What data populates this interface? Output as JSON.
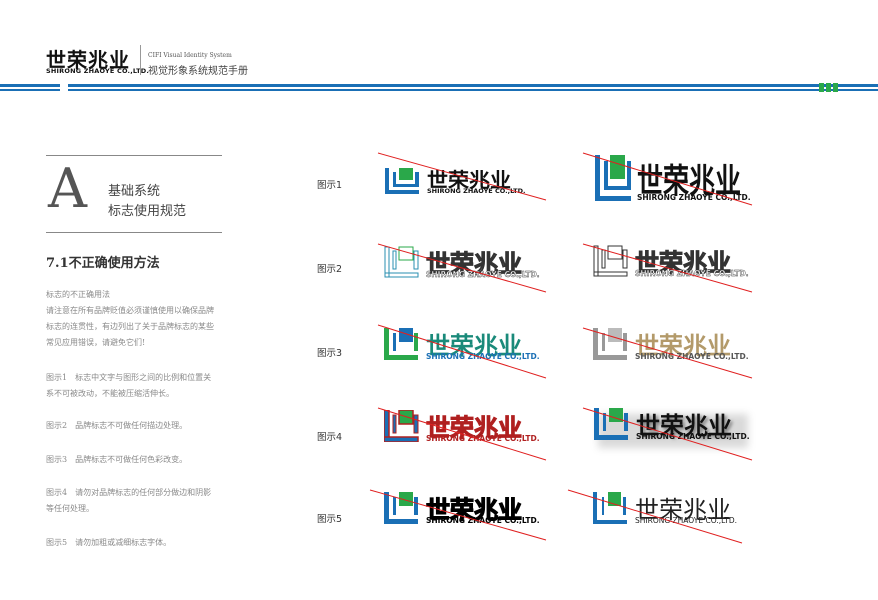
{
  "header": {
    "brand_cn": "世荣兆业",
    "brand_en": "SHIRONG ZHAOYE CO.,LTD.",
    "system_en": "CIFI Visual Identity System",
    "system_cn": "视觉形象系统规范手册"
  },
  "section": {
    "letter": "A",
    "title_line1": "基础系统",
    "title_line2": "标志使用规范",
    "heading": "7.1不正确使用方法"
  },
  "body": {
    "intro": [
      "标志的不正确用法",
      "请注意在所有品牌贬值必须谨慎使用以确保品牌",
      "标志的连贯性，有边列出了关于品牌标志的某些",
      "常见应用错误，请避免它们!"
    ],
    "item1": [
      "图示1　标志中文字与图形之间的比例和位置关",
      "系不可被改动，不能被压缩活伸长。"
    ],
    "item2": "图示2　品牌标志不可做任何描边处理。",
    "item3": "图示3　品牌标志不可做任何色彩改变。",
    "item4": [
      "图示4　请勿对品牌标志的任何部分做边和阴影",
      "等任何处理。"
    ],
    "item5": "图示5　请勿加粗或减细标志字体。"
  },
  "examples": {
    "labels": [
      "图示1",
      "图示2",
      "图示3",
      "图示4",
      "图示5"
    ],
    "logo_cn": "世荣兆业",
    "logo_en": "SHIRONG ZHAOYE CO.,LTD."
  },
  "colors": {
    "brand_blue": "#1a6fb5",
    "brand_green": "#2aa84a",
    "error_red": "#e02020",
    "teal": "#1a8a7a",
    "gold": "#b39a6a",
    "dark_red": "#b02020"
  }
}
